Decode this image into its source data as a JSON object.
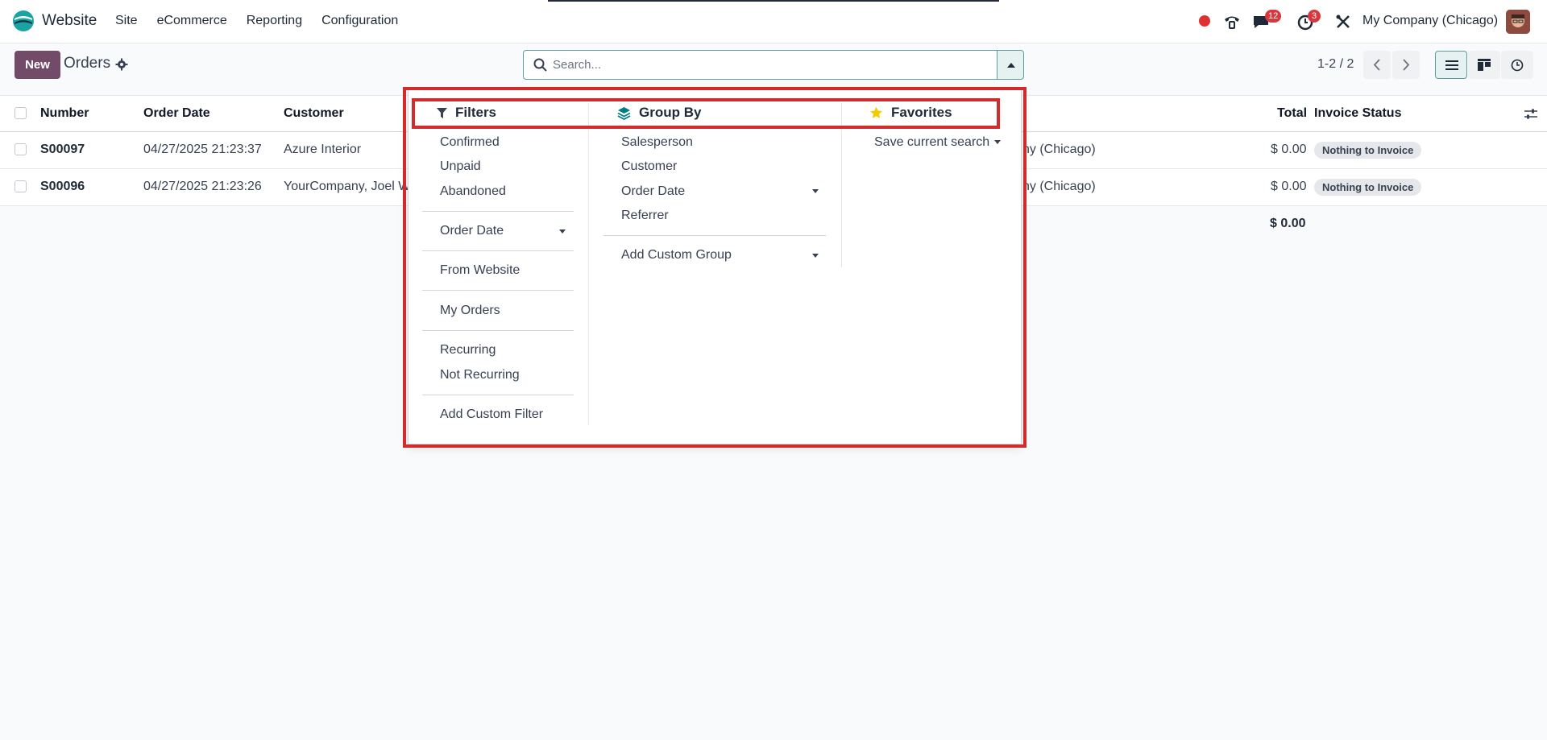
{
  "navbar": {
    "app_name": "Website",
    "menu": [
      "Site",
      "eCommerce",
      "Reporting",
      "Configuration"
    ],
    "messages_badge": "12",
    "activities_badge": "3",
    "company": "My Company (Chicago)"
  },
  "control_panel": {
    "new_label": "New",
    "breadcrumb": "Orders",
    "search_placeholder": "Search...",
    "pager": "1-2 / 2"
  },
  "table": {
    "headers": [
      "Number",
      "Order Date",
      "Customer",
      "Total",
      "Invoice Status"
    ],
    "rows": [
      {
        "number": "S00097",
        "date": "04/27/2025 21:23:37",
        "customer": "Azure Interior",
        "company": "ny (Chicago)",
        "total": "$ 0.00",
        "status": "Nothing to Invoice"
      },
      {
        "number": "S00096",
        "date": "04/27/2025 21:23:26",
        "customer": "YourCompany, Joel W",
        "company": "ny (Chicago)",
        "total": "$ 0.00",
        "status": "Nothing to Invoice"
      }
    ],
    "grand_total": "$ 0.00"
  },
  "dropdown": {
    "filters": {
      "title": "Filters",
      "items": [
        "Confirmed",
        "Unpaid",
        "Abandoned",
        "Order Date",
        "From Website",
        "My Orders",
        "Recurring",
        "Not Recurring",
        "Add Custom Filter"
      ]
    },
    "group_by": {
      "title": "Group By",
      "items": [
        "Salesperson",
        "Customer",
        "Order Date",
        "Referrer",
        "Add Custom Group"
      ]
    },
    "favorites": {
      "title": "Favorites",
      "items": [
        "Save current search"
      ]
    }
  },
  "colors": {
    "brand": "#714b67",
    "highlight": "#d22b2b",
    "badge": "#d9363e",
    "teal": "#017e84",
    "star": "#f3cc00"
  }
}
